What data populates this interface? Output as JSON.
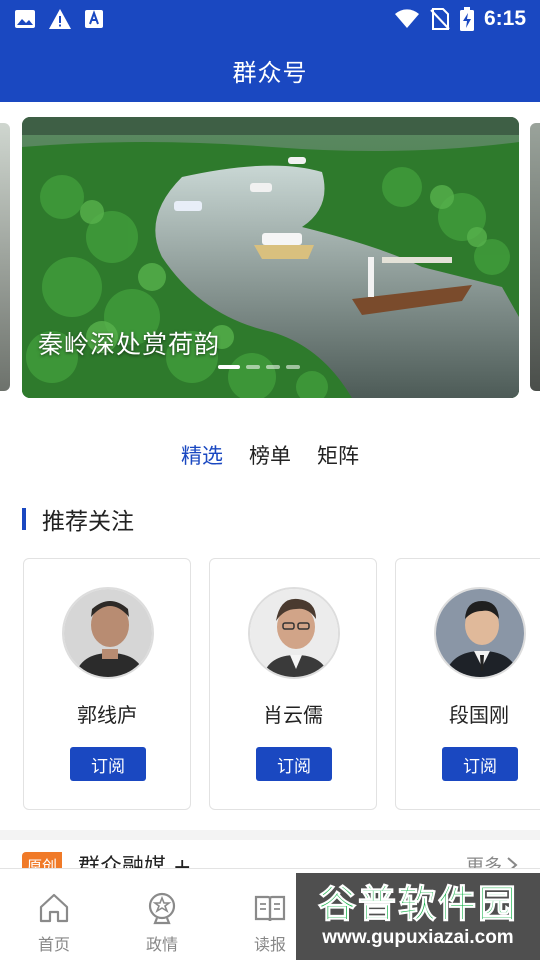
{
  "status_bar": {
    "time": "6:15"
  },
  "header": {
    "title": "群众号"
  },
  "banner": {
    "caption": "秦岭深处赏荷韵"
  },
  "tabs": [
    {
      "label": "精选",
      "active": true
    },
    {
      "label": "榜单",
      "active": false
    },
    {
      "label": "矩阵",
      "active": false
    }
  ],
  "recommend": {
    "title": "推荐关注",
    "cards": [
      {
        "name": "郭线庐",
        "button": "订阅"
      },
      {
        "name": "肖云儒",
        "button": "订阅"
      },
      {
        "name": "段国刚",
        "button": "订阅"
      }
    ]
  },
  "next_section": {
    "badge": "原创",
    "title": "群众融媒 +",
    "more": "更多"
  },
  "bottom_nav": [
    {
      "label": "首页",
      "icon": "home-icon"
    },
    {
      "label": "政情",
      "icon": "politics-icon"
    },
    {
      "label": "读报",
      "icon": "newspaper-icon"
    },
    {
      "label": "",
      "icon": ""
    },
    {
      "label": "",
      "icon": ""
    }
  ],
  "watermark": {
    "big": "谷普软件园",
    "small": "www.gupuxiazai.com"
  },
  "colors": {
    "brand": "#1a48c1",
    "badge": "#f07a28",
    "watermark": "#16b24a"
  }
}
